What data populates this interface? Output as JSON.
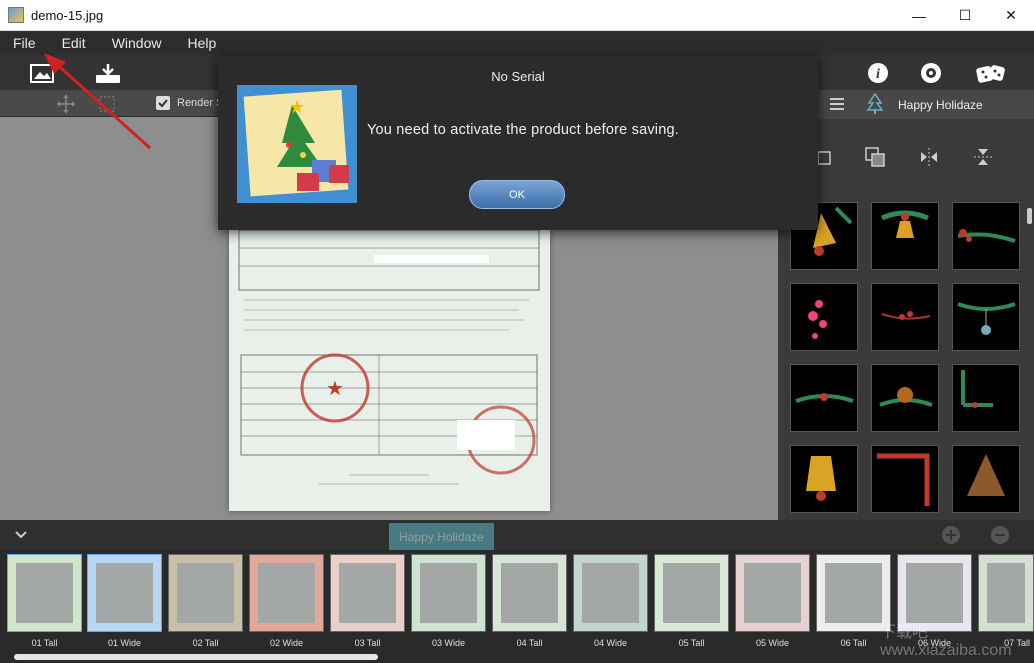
{
  "window": {
    "title": "demo-15.jpg",
    "minimize": "—",
    "maximize": "☐",
    "close": "✕"
  },
  "menu": [
    "File",
    "Edit",
    "Window",
    "Help"
  ],
  "subbar": {
    "render_label": "Render S"
  },
  "right_panel": {
    "heading": "Happy Holidaze"
  },
  "dialog": {
    "title": "No Serial",
    "message": "You need to activate the product before saving.",
    "ok": "OK"
  },
  "strip": {
    "tab": "Happy Holidaze",
    "frames": [
      "01 Tall",
      "01 Wide",
      "02 Tall",
      "02 Wide",
      "03 Tall",
      "03 Wide",
      "04 Tall",
      "04 Wide",
      "05 Tall",
      "05 Wide",
      "06 Tall",
      "06 Wide",
      "07 Tall"
    ]
  },
  "watermark": "下载吧 www.xiazaiba.com",
  "colors": {
    "accent": "#5fb6c7",
    "dialog_bg": "#2b2b2b",
    "arrow": "#d42020"
  }
}
